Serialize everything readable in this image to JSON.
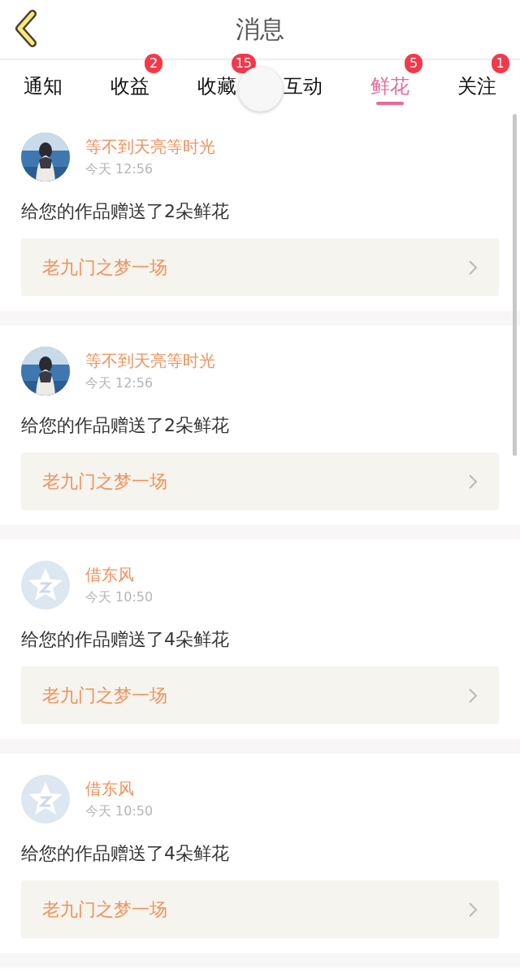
{
  "header": {
    "title": "消息"
  },
  "tabs": [
    {
      "label": "通知",
      "selected": false
    },
    {
      "label": "收益",
      "selected": false,
      "badge": "2"
    },
    {
      "label": "收藏",
      "selected": false,
      "badge": "15"
    },
    {
      "label": "互动",
      "selected": false
    },
    {
      "label": "鲜花",
      "selected": true,
      "badge": "5"
    },
    {
      "label": "关注",
      "selected": false,
      "badge": "1"
    }
  ],
  "messages": [
    {
      "user": "等不到天亮等时光",
      "time": "今天 12:56",
      "text": "给您的作品赠送了2朵鲜花",
      "work": "老九门之梦一场"
    },
    {
      "user": "等不到天亮等时光",
      "time": "今天 12:56",
      "text": "给您的作品赠送了2朵鲜花",
      "work": "老九门之梦一场"
    },
    {
      "avatar": {
        "kind": "default"
      },
      "user": "借东风",
      "time": "今天 10:50",
      "text": "给您的作品赠送了4朵鲜花",
      "work": "老九门之梦一场"
    },
    {
      "avatar": {
        "kind": "default"
      },
      "user": "借东风",
      "time": "今天 10:50",
      "text": "给您的作品赠送了4朵鲜花",
      "work": "老九门之梦一场"
    }
  ]
}
